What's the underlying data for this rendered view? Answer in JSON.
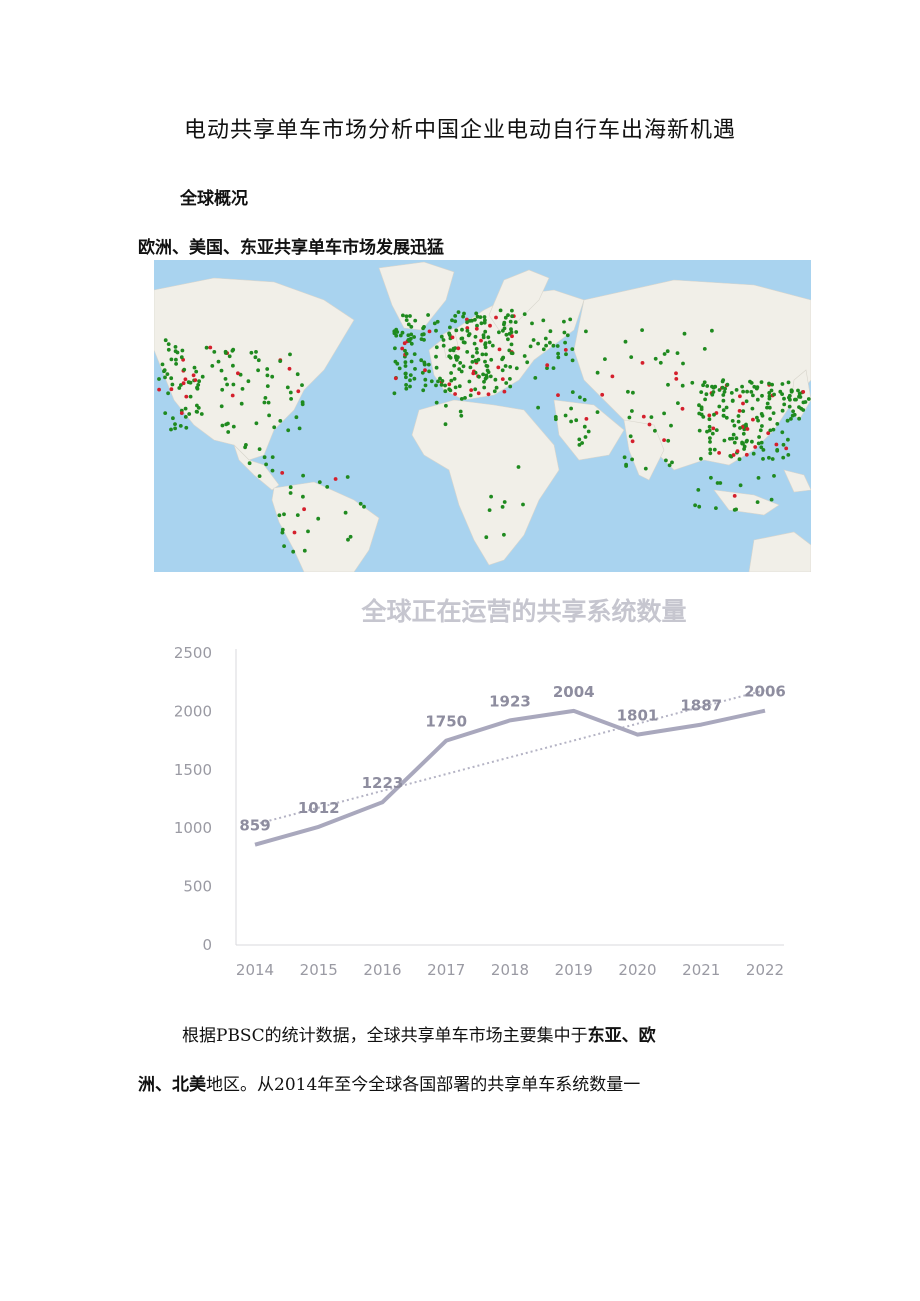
{
  "title": "电动共享单车市场分析中国企业电动自行车出海新机遇",
  "section_heading": "全球概况",
  "subheading": "欧洲、美国、东亚共享单车市场发展迅猛",
  "colors": {
    "ocean": "#a9d3ef",
    "land": "#f1efe8",
    "dot_green": "#1f8a1f",
    "dot_red": "#d41f2c",
    "line": "#a9a8bd",
    "trend": "#b4b3c4"
  },
  "chart_data": {
    "type": "line",
    "title": "全球正在运营的共享系统数量",
    "categories": [
      "2014",
      "2015",
      "2016",
      "2017",
      "2018",
      "2019",
      "2020",
      "2021",
      "2022"
    ],
    "values": [
      859,
      1012,
      1223,
      1750,
      1923,
      2004,
      1801,
      1887,
      2006
    ],
    "data_labels": [
      "859",
      "1012",
      "1223",
      "1750",
      "1923",
      "2004",
      "1801",
      "1887",
      "2006"
    ],
    "ylim": [
      0,
      2500
    ],
    "yticks": [
      "0",
      "500",
      "1000",
      "1500",
      "2000",
      "2500"
    ],
    "trendline": "linear (dotted)",
    "grid": false
  },
  "paragraph": {
    "p1_a": "根据PBSC的统计数据，全球共享单车市场主要集中于",
    "p1_b": "东亚、欧",
    "p2_a": "洲、北美",
    "p2_b": "地区。从2014年至今全球各国部署的共享单车系统数量一"
  }
}
